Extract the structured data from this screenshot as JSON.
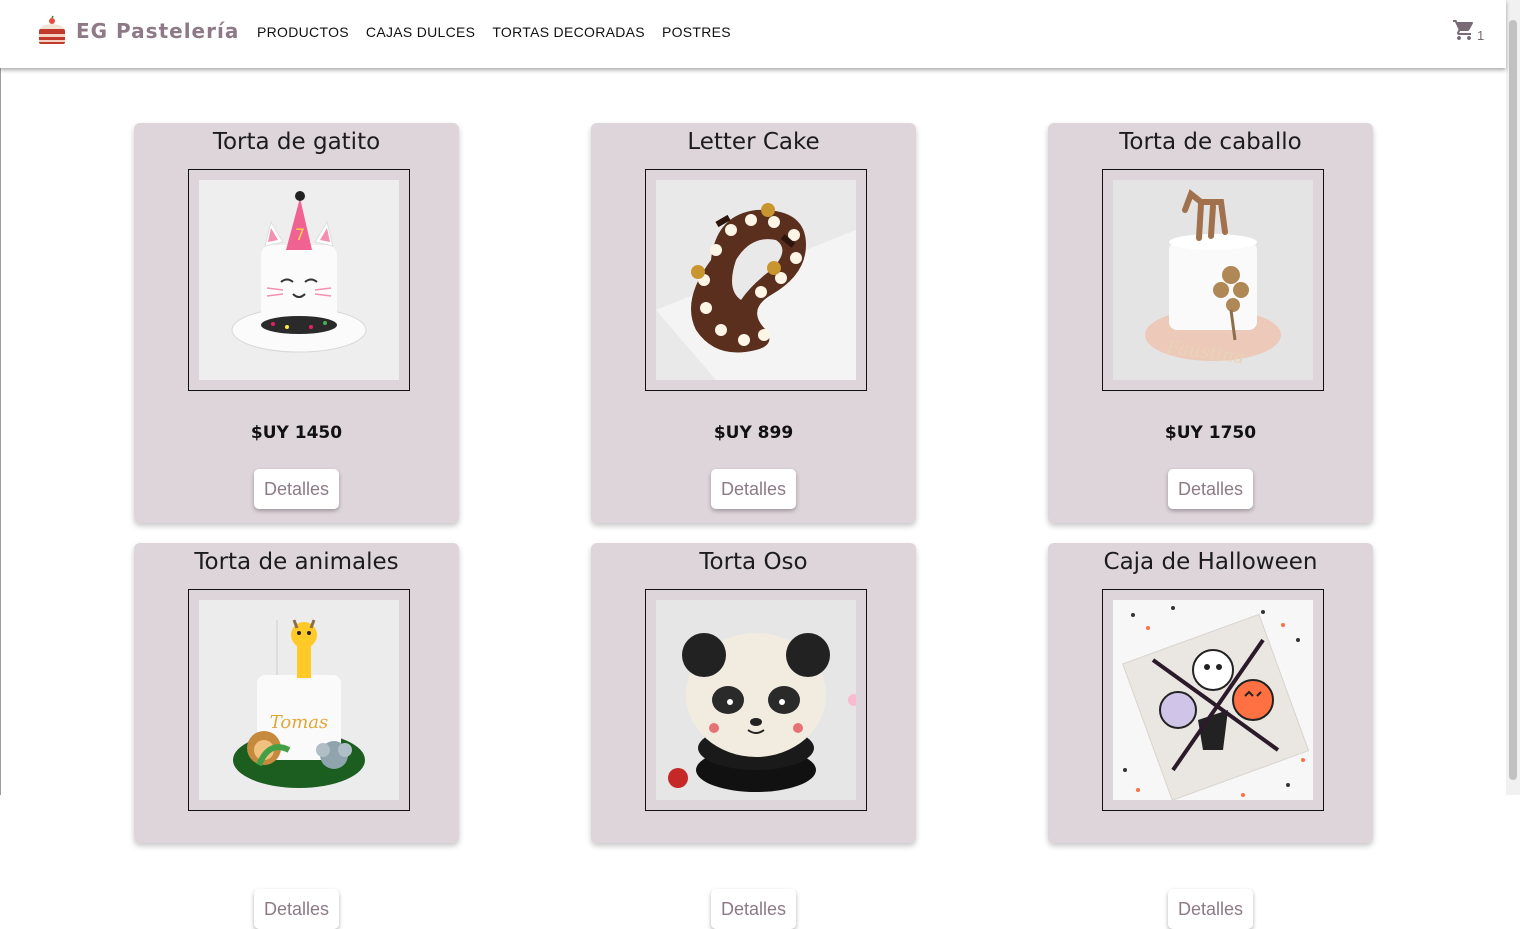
{
  "brand": {
    "name": "EG Pastelería",
    "logo_icon": "cake-icon"
  },
  "nav": [
    "PRODUCTOS",
    "CAJAS DULCES",
    "TORTAS DECORADAS",
    "POSTRES"
  ],
  "cart": {
    "icon": "shopping-cart-icon",
    "count": "1"
  },
  "colors": {
    "card_bg": "#ded5da",
    "brand": "#8d7a86"
  },
  "products": [
    {
      "title": "Torta de gatito",
      "price": "$UY 1450",
      "button": "Detalles"
    },
    {
      "title": "Letter Cake",
      "price": "$UY 899",
      "button": "Detalles"
    },
    {
      "title": "Torta de caballo",
      "price": "$UY 1750",
      "button": "Detalles"
    },
    {
      "title": "Torta de animales",
      "price": "",
      "button": "Detalles"
    },
    {
      "title": "Torta Oso",
      "price": "",
      "button": "Detalles"
    },
    {
      "title": "Caja de Halloween",
      "price": "",
      "button": "Detalles"
    }
  ]
}
